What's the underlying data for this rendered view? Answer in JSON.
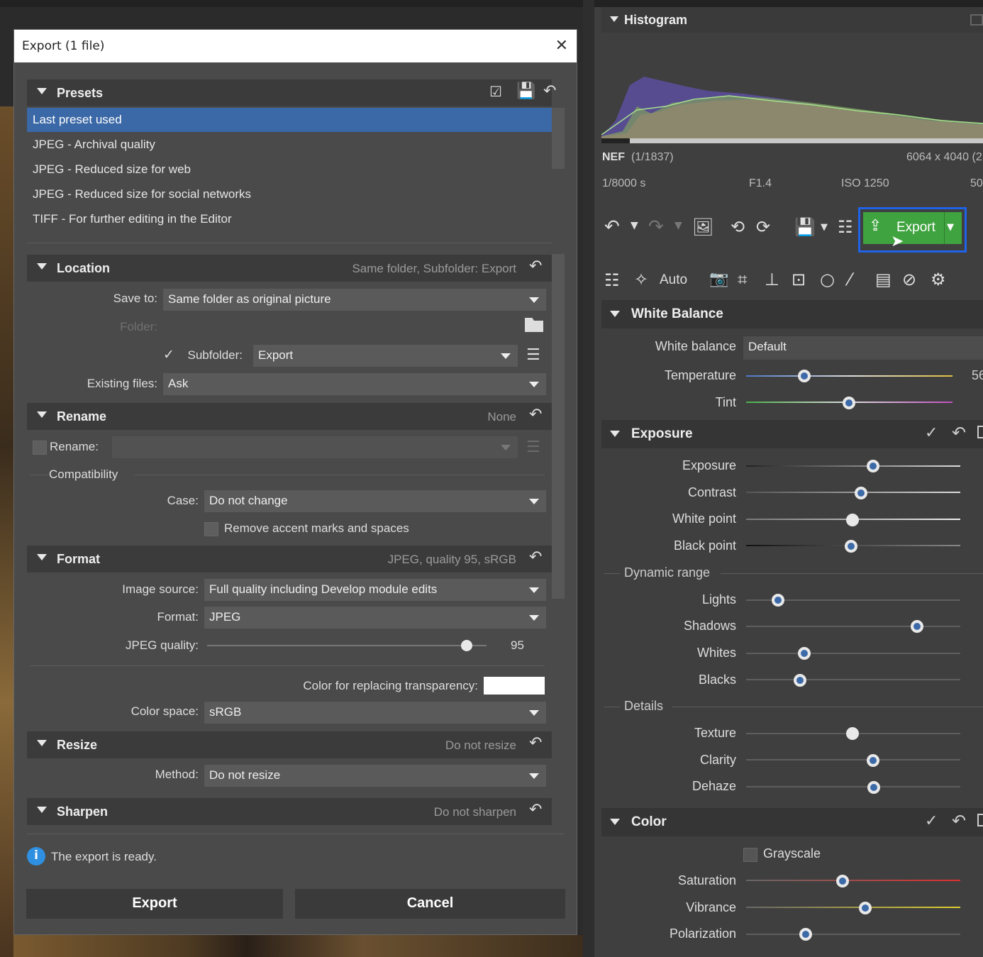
{
  "dialog": {
    "title": "Export (1 file)",
    "presets": {
      "title": "Presets",
      "items": [
        "Last preset used",
        "JPEG - Archival quality",
        "JPEG - Reduced size for web",
        "JPEG - Reduced size for social networks",
        "TIFF - For further editing in the Editor"
      ]
    },
    "location": {
      "title": "Location",
      "summary": "Same folder, Subfolder: Export",
      "save_to_label": "Save to:",
      "save_to_value": "Same folder as original picture",
      "folder_placeholder": "Folder:",
      "subfolder_label": "Subfolder:",
      "subfolder_value": "Export",
      "existing_label": "Existing files:",
      "existing_value": "Ask"
    },
    "rename": {
      "title": "Rename",
      "summary": "None",
      "rename_label": "Rename:",
      "compat_label": "Compatibility",
      "case_label": "Case:",
      "case_value": "Do not change",
      "accent_label": "Remove accent marks and spaces"
    },
    "format": {
      "title": "Format",
      "summary": "JPEG, quality 95, sRGB",
      "source_label": "Image source:",
      "source_value": "Full quality including Develop module edits",
      "format_label": "Format:",
      "format_value": "JPEG",
      "quality_label": "JPEG quality:",
      "quality_value": "95",
      "transparency_label": "Color for replacing transparency:",
      "colorspace_label": "Color space:",
      "colorspace_value": "sRGB"
    },
    "resize": {
      "title": "Resize",
      "summary": "Do not resize",
      "method_label": "Method:",
      "method_value": "Do not resize"
    },
    "sharpen": {
      "title": "Sharpen",
      "summary": "Do not sharpen"
    },
    "status": "The export is ready.",
    "export_btn": "Export",
    "cancel_btn": "Cancel"
  },
  "panel": {
    "histogram_title": "Histogram",
    "file_type": "NEF",
    "file_index": "(1/1837)",
    "resolution": "6064 x 4040 (2",
    "shutter": "1/8000 s",
    "aperture": "F1.4",
    "iso": "ISO 1250",
    "focal": "50",
    "export_btn": "Export",
    "auto_label": "Auto",
    "white_balance": {
      "title": "White Balance",
      "wb_label": "White balance",
      "wb_value": "Default",
      "temp_label": "Temperature",
      "temp_value": "56",
      "tint_label": "Tint"
    },
    "exposure": {
      "title": "Exposure",
      "sliders": [
        {
          "label": "Exposure"
        },
        {
          "label": "Contrast"
        },
        {
          "label": "White point"
        },
        {
          "label": "Black point"
        }
      ],
      "dynamic_range": "Dynamic range",
      "dr_sliders": [
        {
          "label": "Lights"
        },
        {
          "label": "Shadows"
        },
        {
          "label": "Whites"
        },
        {
          "label": "Blacks"
        }
      ],
      "details": "Details",
      "detail_sliders": [
        {
          "label": "Texture"
        },
        {
          "label": "Clarity"
        },
        {
          "label": "Dehaze"
        }
      ]
    },
    "color": {
      "title": "Color",
      "grayscale": "Grayscale",
      "sliders": [
        {
          "label": "Saturation"
        },
        {
          "label": "Vibrance"
        },
        {
          "label": "Polarization"
        }
      ]
    }
  }
}
